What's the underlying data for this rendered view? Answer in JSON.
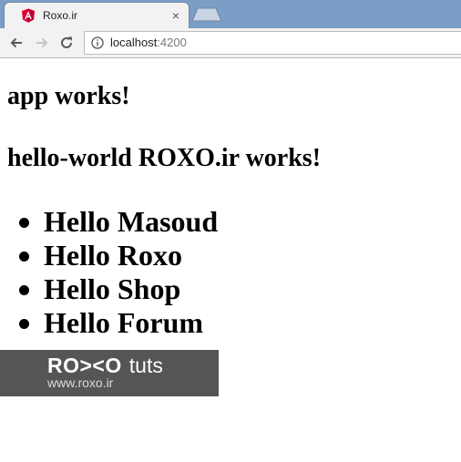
{
  "browser": {
    "tab": {
      "title": "Roxo.ir",
      "close_glyph": "×",
      "favicon": "angular-icon"
    },
    "address_bar": {
      "host": "localhost",
      "port": ":4200",
      "security_icon": "info-icon"
    },
    "nav_icons": [
      "back-arrow-icon",
      "forward-arrow-icon",
      "reload-icon"
    ]
  },
  "page": {
    "app_heading": "app works!",
    "hello_heading": "hello-world ROXO.ir works!",
    "greetings": [
      "Hello Masoud",
      "Hello Roxo",
      "Hello Shop",
      "Hello Forum"
    ],
    "banner": {
      "logo": "RO><O",
      "suffix": "tuts",
      "url": "www.roxo.ir"
    }
  },
  "colors": {
    "tabstrip": "#7a9ec6",
    "angular_red": "#dd0031",
    "banner_bg": "#555555"
  }
}
